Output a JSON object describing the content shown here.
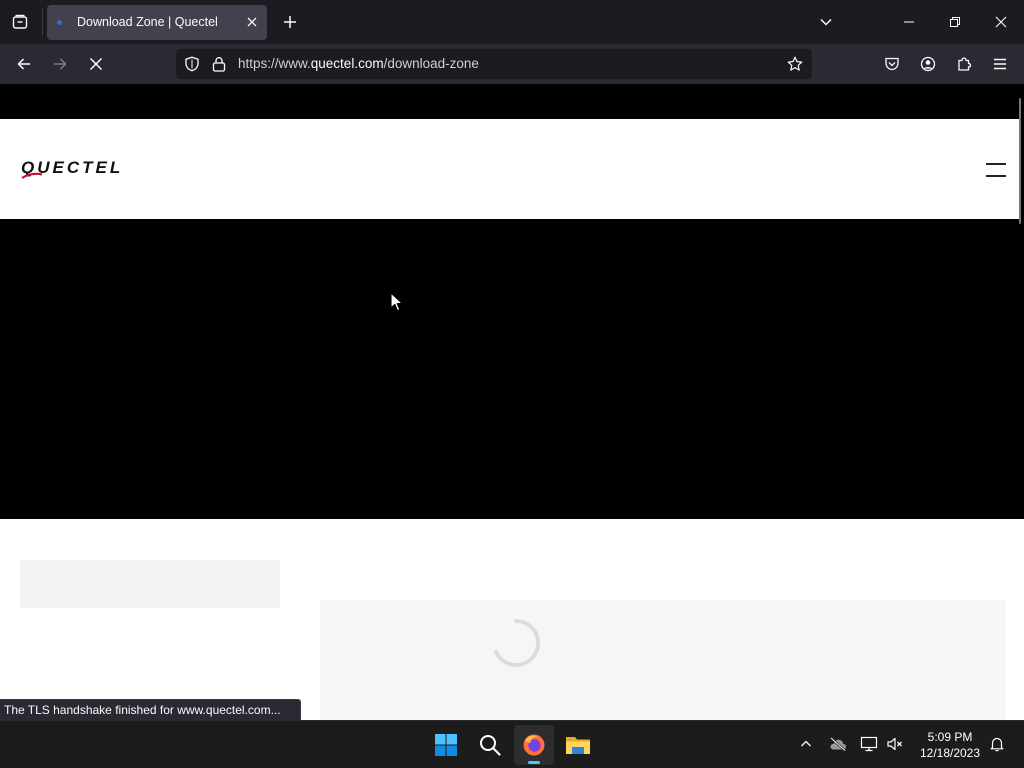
{
  "browser": {
    "tab": {
      "title": "Download Zone | Quectel",
      "favicon": "loading-dot-icon"
    },
    "address": {
      "scheme_host_prefix": "https://www.",
      "domain": "quectel.com",
      "path": "/download-zone"
    },
    "status_text": "The TLS handshake finished for www.quectel.com..."
  },
  "site": {
    "brand": "QUECTEL",
    "brand_color": "#c8102e"
  },
  "taskbar": {
    "apps": [
      "start-icon",
      "search-icon",
      "firefox-icon",
      "file-explorer-icon"
    ],
    "clock": {
      "time": "5:09 PM",
      "date": "12/18/2023"
    }
  },
  "colors": {
    "tabstrip_bg": "#1c1b22",
    "navbar_bg": "#2b2a33",
    "active_tab_bg": "#42414d",
    "taskbar_bg": "#1c1c1c",
    "accent": "#4cc2ff"
  }
}
